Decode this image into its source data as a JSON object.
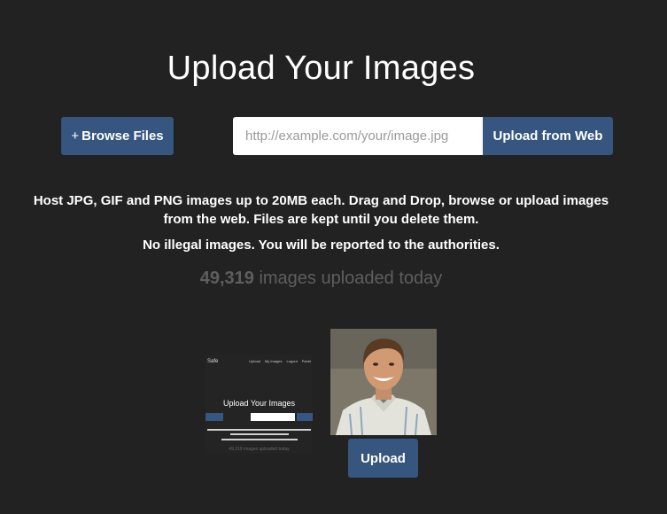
{
  "header": {
    "title": "Upload Your Images"
  },
  "toolbar": {
    "browse_plus": "+",
    "browse_label": "Browse Files",
    "url_placeholder": "http://example.com/your/image.jpg",
    "web_upload_label": "Upload from Web"
  },
  "info": {
    "description": "Host JPG, GIF and PNG images up to 20MB each. Drag and Drop, browse or upload images from the web. Files are kept until you delete them.",
    "warning": "No illegal images. You will be reported to the authorities.",
    "count": "49,319",
    "count_suffix": " images uploaded today"
  },
  "queue": {
    "screenshot_thumb": {
      "logo": "Safe",
      "nav": [
        "Upload",
        "My Images",
        "Logout",
        "Panel"
      ],
      "title": "Upload Your Images",
      "count": "49,319 images uploaded today"
    },
    "upload_label": "Upload"
  },
  "colors": {
    "background": "#222222",
    "accent": "#36557f",
    "muted": "#5e5e5e"
  }
}
